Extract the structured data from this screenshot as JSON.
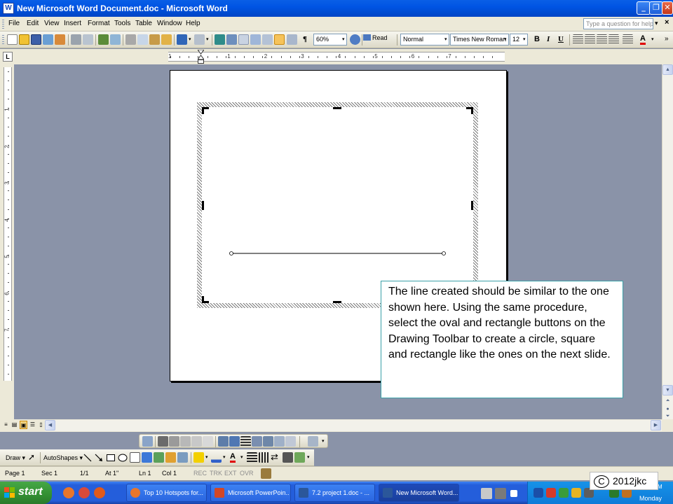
{
  "window": {
    "title": "New Microsoft Word Document.doc - Microsoft Word",
    "app_icon_letter": "W"
  },
  "menu": {
    "items": [
      "File",
      "Edit",
      "View",
      "Insert",
      "Format",
      "Tools",
      "Table",
      "Window",
      "Help"
    ],
    "help_placeholder": "Type a question for help"
  },
  "toolbar": {
    "zoom": "60%",
    "read_label": "Read",
    "style": "Normal",
    "font": "Times New Roman",
    "size": "12",
    "bold": "B",
    "italic": "I",
    "underline": "U",
    "font_color_letter": "A",
    "pilcrow": "¶"
  },
  "ruler": {
    "corner": "L",
    "numbers": [
      "1",
      "1",
      "2",
      "3",
      "4",
      "5",
      "6",
      "7"
    ]
  },
  "vruler": {
    "numbers": [
      "1",
      "2",
      "3",
      "4",
      "5",
      "6",
      "7"
    ]
  },
  "drawing_toolbar": {
    "draw_label": "Draw",
    "autoshapes_label": "AutoShapes",
    "font_color_letter": "A"
  },
  "status": {
    "page": "Page 1",
    "sec": "Sec 1",
    "pages": "1/1",
    "at": "At 1\"",
    "ln": "Ln 1",
    "col": "Col 1",
    "flags": [
      "REC",
      "TRK",
      "EXT",
      "OVR"
    ]
  },
  "taskbar": {
    "start_label": "start",
    "tasks": [
      {
        "label": "Top 10 Hotspots for...",
        "color": "#e8762b",
        "active": false
      },
      {
        "label": "Microsoft PowerPoin...",
        "color": "#d24726",
        "active": false
      },
      {
        "label": "7.2 project 1.doc - ...",
        "color": "#2b579a",
        "active": false
      },
      {
        "label": "New Microsoft Word...",
        "color": "#2b579a",
        "active": true
      }
    ],
    "clock_day": "Monday",
    "clock_m": "M"
  },
  "callout": {
    "text": "The line created should be similar to the one shown here. Using the same procedure, select the oval and rectangle buttons on the Drawing Toolbar to create a circle, square and rectangle like the ones on the next slide."
  },
  "copyright": {
    "symbol": "C",
    "text": "2012jkc"
  }
}
